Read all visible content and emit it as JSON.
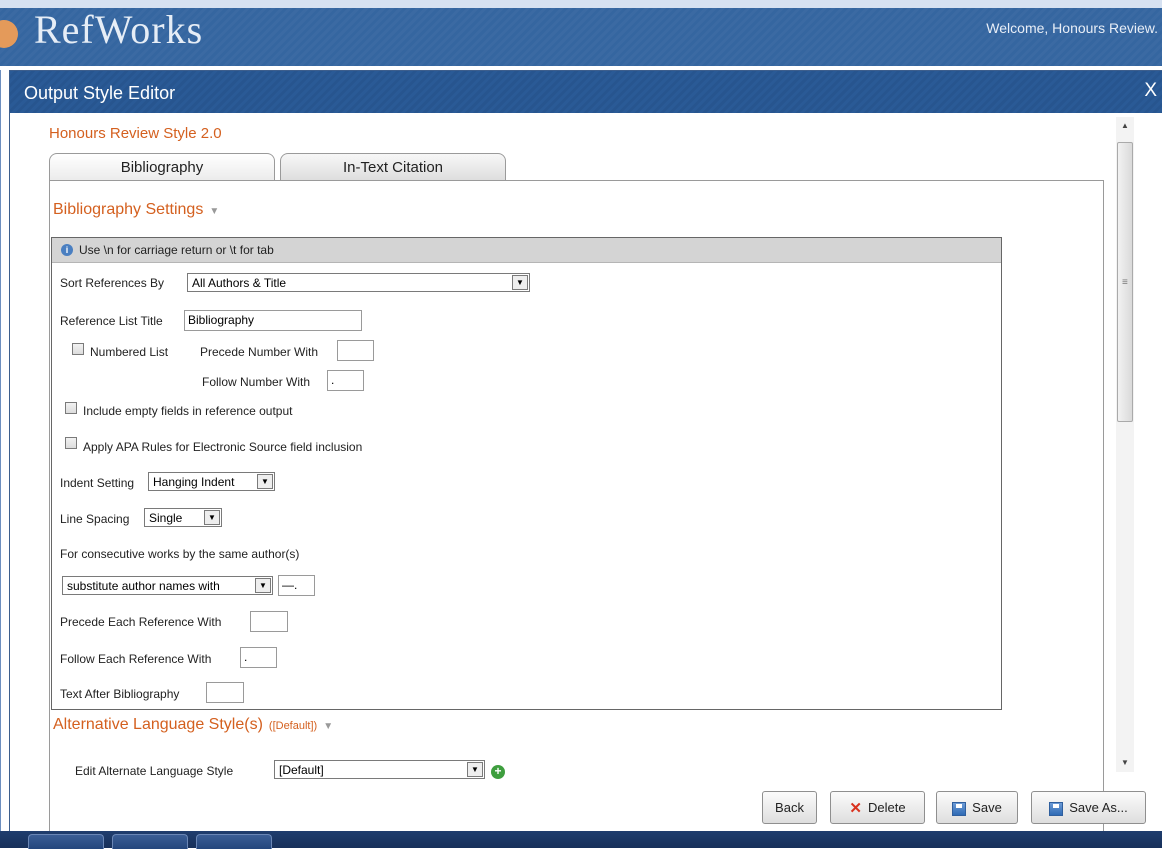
{
  "app": {
    "logo_text": "RefWorks",
    "welcome": "Welcome, Honours Review."
  },
  "dialog": {
    "title": "Output Style Editor",
    "close_label": "X",
    "style_name": "Honours Review Style 2.0",
    "tabs": [
      {
        "label": "Bibliography",
        "active": true
      },
      {
        "label": "In-Text Citation",
        "active": false
      }
    ]
  },
  "bibliography_settings": {
    "heading": "Bibliography Settings",
    "info_text": "Use \\n for carriage return or \\t for tab",
    "sort_references_by": {
      "label": "Sort References By",
      "value": "All Authors & Title"
    },
    "reference_list_title": {
      "label": "Reference List Title",
      "value": "Bibliography"
    },
    "numbered_list": {
      "label": "Numbered List",
      "checked": false
    },
    "precede_number_with": {
      "label": "Precede Number With",
      "value": ""
    },
    "follow_number_with": {
      "label": "Follow Number With",
      "value": "."
    },
    "include_empty_fields": {
      "label": "Include empty fields in reference output",
      "checked": false
    },
    "apa_rules": {
      "label": "Apply APA Rules for Electronic Source field inclusion",
      "checked": false
    },
    "indent_setting": {
      "label": "Indent Setting",
      "value": "Hanging Indent"
    },
    "line_spacing": {
      "label": "Line Spacing",
      "value": "Single"
    },
    "consecutive_works": {
      "label": "For consecutive works by the same author(s)",
      "option": "substitute author names with",
      "substitute_value": "—."
    },
    "precede_each_reference": {
      "label": "Precede Each Reference With",
      "value": ""
    },
    "follow_each_reference": {
      "label": "Follow Each Reference With",
      "value": "."
    },
    "text_after_bibliography": {
      "label": "Text After Bibliography",
      "value": ""
    }
  },
  "alternative_language": {
    "heading": "Alternative Language Style(s)",
    "default_tag": "([Default])",
    "edit_label": "Edit Alternate Language Style",
    "edit_value": "[Default]"
  },
  "buttons": {
    "back": "Back",
    "delete": "Delete",
    "save": "Save",
    "save_as": "Save As..."
  },
  "colors": {
    "accent_orange": "#d4601f",
    "header_blue": "#2a5a96"
  }
}
